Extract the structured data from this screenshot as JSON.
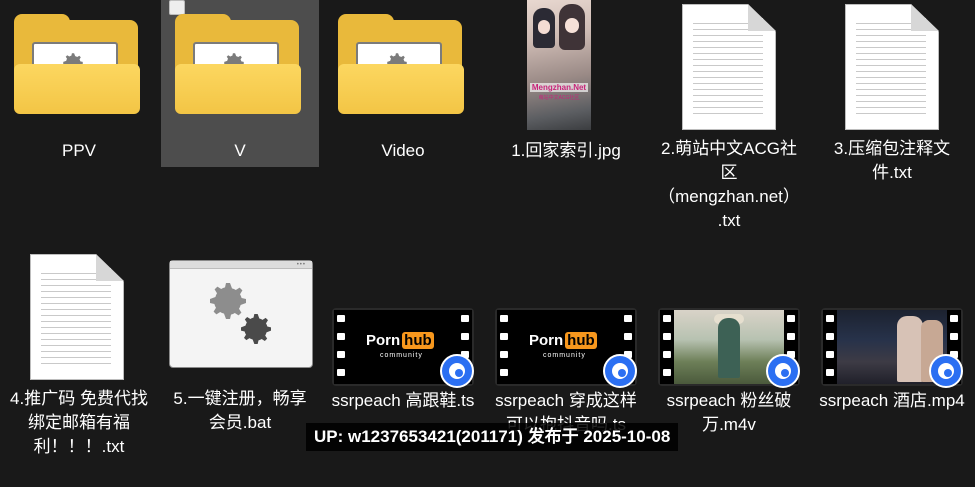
{
  "files": [
    {
      "label": "PPV",
      "type": "folder",
      "icon": "folder-icon"
    },
    {
      "label": "V",
      "type": "folder",
      "icon": "folder-icon",
      "selected": true
    },
    {
      "label": "Video",
      "type": "folder",
      "icon": "folder-icon"
    },
    {
      "label": "1.回家索引.jpg",
      "type": "image",
      "icon": "image-thumbnail",
      "watermark": "Mengzhan.Net",
      "watermark_sub": "萌站中文ACG社区"
    },
    {
      "label": "2.萌站中文ACG社区（mengzhan.net）.txt",
      "type": "text",
      "icon": "text-document-icon"
    },
    {
      "label": "3.压缩包注释文件.txt",
      "type": "text",
      "icon": "text-document-icon"
    },
    {
      "label": "4.推广码 免费代找 绑定邮箱有福利！！！.txt",
      "type": "text",
      "icon": "text-document-icon"
    },
    {
      "label": "5.一键注册，畅享会员.bat",
      "type": "batch",
      "icon": "gear-settings-icon"
    },
    {
      "label": "ssrpeach  高跟鞋.ts",
      "type": "video",
      "icon": "video-thumbnail",
      "thumb_logo": "Porn",
      "thumb_logo_hub": "hub",
      "thumb_sub": "community"
    },
    {
      "label": "ssrpeach 穿成这样可以抱抖音吗.ts",
      "type": "video",
      "icon": "video-thumbnail",
      "thumb_logo": "Porn",
      "thumb_logo_hub": "hub",
      "thumb_sub": "community"
    },
    {
      "label": "ssrpeach 粉丝破万.m4v",
      "type": "video",
      "icon": "video-thumbnail"
    },
    {
      "label": "ssrpeach 酒店.mp4",
      "type": "video",
      "icon": "video-thumbnail"
    }
  ],
  "overlay": {
    "text": "UP: w1237653421(201171) 发布于 2025-10-08"
  },
  "colors": {
    "background": "#191919",
    "selection": "#4d4d4d",
    "folder": "#f3c545",
    "badge": "#2b6ff2"
  }
}
